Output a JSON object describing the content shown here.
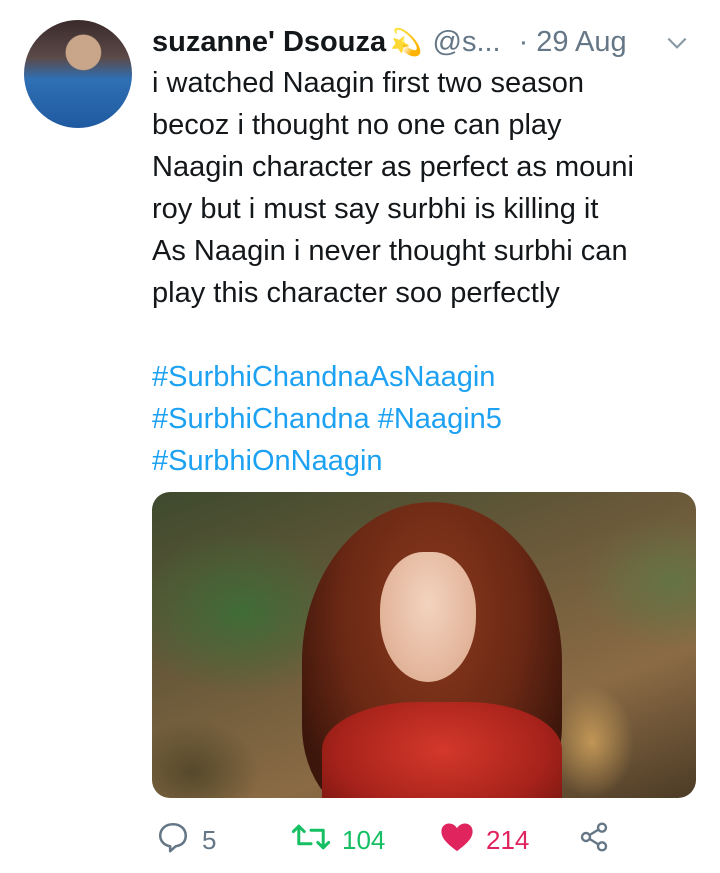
{
  "tweet": {
    "author_name": "suzanne' Dsouza",
    "author_emoji": "💫",
    "handle": "@s...",
    "separator": "·",
    "date": "29 Aug",
    "text": "i watched Naagin first two season\nbecoz i thought no one can play\nNaagin character as perfect as mouni\nroy  but i must say surbhi is killing it\nAs Naagin i never thought surbhi can\nplay this character soo perfectly",
    "hashtags": [
      "#SurbhiChandnaAsNaagin",
      "#SurbhiChandna",
      "#Naagin5",
      "#SurbhiOnNaagin"
    ]
  },
  "actions": {
    "reply_count": "5",
    "retweet_count": "104",
    "like_count": "214"
  },
  "colors": {
    "link": "#1da1f2",
    "retweet": "#17bf63",
    "like": "#e0245e",
    "muted": "#657786"
  },
  "icons": [
    "reply-icon",
    "retweet-icon",
    "heart-icon",
    "share-icon",
    "chevron-down-icon"
  ]
}
